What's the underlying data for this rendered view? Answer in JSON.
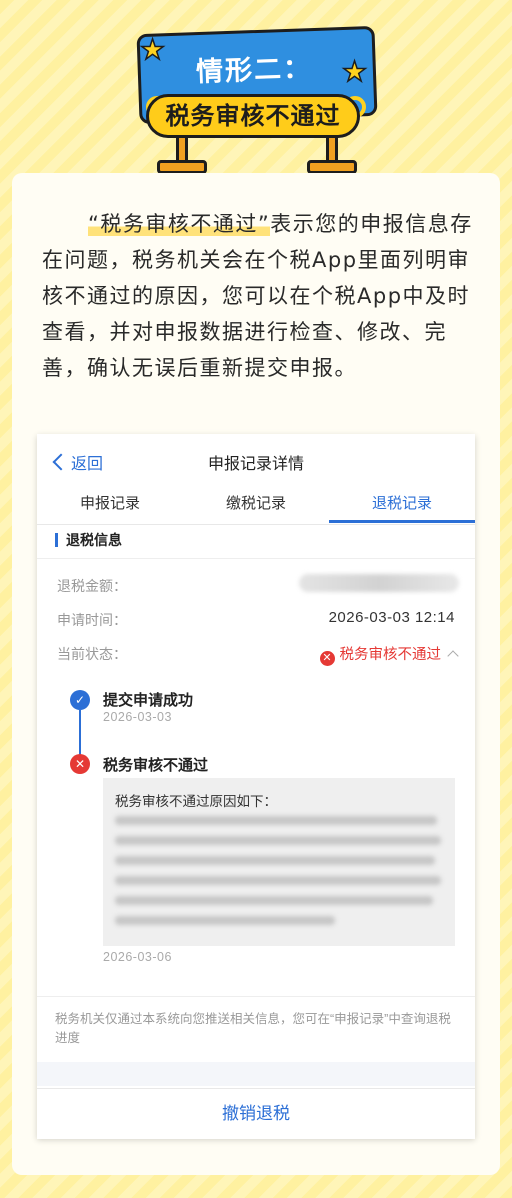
{
  "colors": {
    "accent": "#2c6fd6",
    "error": "#e53935",
    "sign_blue": "#2f8fe0",
    "sign_yellow": "#ffcc1a",
    "background": "#fff3a8"
  },
  "sign": {
    "title": "情形二：",
    "subtitle": "税务审核不通过",
    "icons": [
      "star-icon",
      "star-icon"
    ]
  },
  "intro": {
    "quote": "“税务审核不通过”",
    "part1": "表示您的申报信息存在问题，",
    "part2": "税务机关会在个税App里面列明审核不通过的原因，您可以在个税App中及时查看，并对申报数据进行检查、修改、完善，确认无误后重新提交申报。"
  },
  "phone": {
    "back_label": "返回",
    "title": "申报记录详情",
    "tabs": [
      {
        "label": "申报记录"
      },
      {
        "label": "缴税记录"
      },
      {
        "label": "退税记录"
      }
    ],
    "active_tab": "退税记录",
    "section_title": "退税信息",
    "fields": {
      "amount_label": "退税金额：",
      "time_label": "申请时间：",
      "time_value": "2026-03-03 12:14",
      "status_label": "当前状态：",
      "status_value": "税务审核不通过"
    },
    "timeline": [
      {
        "title": "提交申请成功",
        "date": "2026-03-03",
        "icon": "check-icon"
      },
      {
        "title": "税务审核不通过",
        "date": "2026-03-06",
        "icon": "close-icon"
      }
    ],
    "reason_title": "税务审核不通过原因如下：",
    "notice": "税务机关仅通过本系统向您推送相关信息，您可在“申报记录”中查询退税进度",
    "cancel_button": "撤销退税"
  }
}
